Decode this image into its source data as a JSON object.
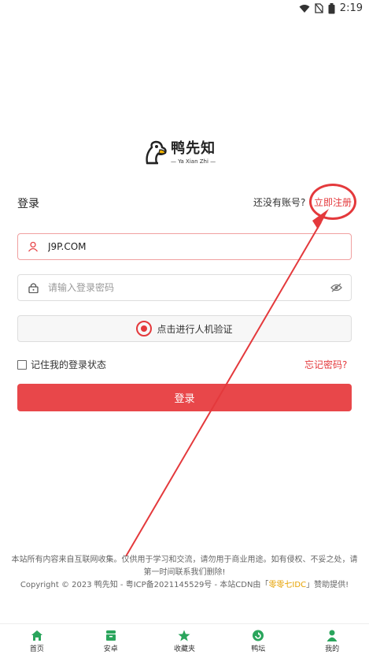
{
  "status_bar": {
    "time": "2:19"
  },
  "brand": {
    "name": "鸭先知",
    "subtitle": "— Ya Xian Zhi —"
  },
  "login": {
    "title": "登录",
    "no_account_text": "还没有账号?",
    "register_link": "立即注册",
    "username_value": "J9P.COM",
    "password_placeholder": "请输入登录密码",
    "captcha_label": "点击进行人机验证",
    "remember_label": "记住我的登录状态",
    "forgot_link": "忘记密码?",
    "submit_label": "登录"
  },
  "footer": {
    "line1": "本站所有内容来自互联网收集。仅供用于学习和交流，请勿用于商业用途。如有侵权、不妥之处，请第一时间联系我们删除!",
    "copyright_prefix": "Copyright © 2023 鸭先知 - 粤ICP备2021145529号 - 本站CDN由「",
    "cdn_name": "零零七IDC",
    "copyright_suffix": "」赞助提供!"
  },
  "tabbar": {
    "items": [
      {
        "label": "首页",
        "icon": "home-icon"
      },
      {
        "label": "安卓",
        "icon": "android-icon"
      },
      {
        "label": "收藏夹",
        "icon": "star-icon"
      },
      {
        "label": "鸭坛",
        "icon": "forum-icon"
      },
      {
        "label": "我的",
        "icon": "user-icon"
      }
    ]
  },
  "colors": {
    "accent": "#e8474a",
    "link": "#e4393c",
    "tab_icon": "#2aa55c",
    "cdn_highlight": "#e6a100"
  }
}
